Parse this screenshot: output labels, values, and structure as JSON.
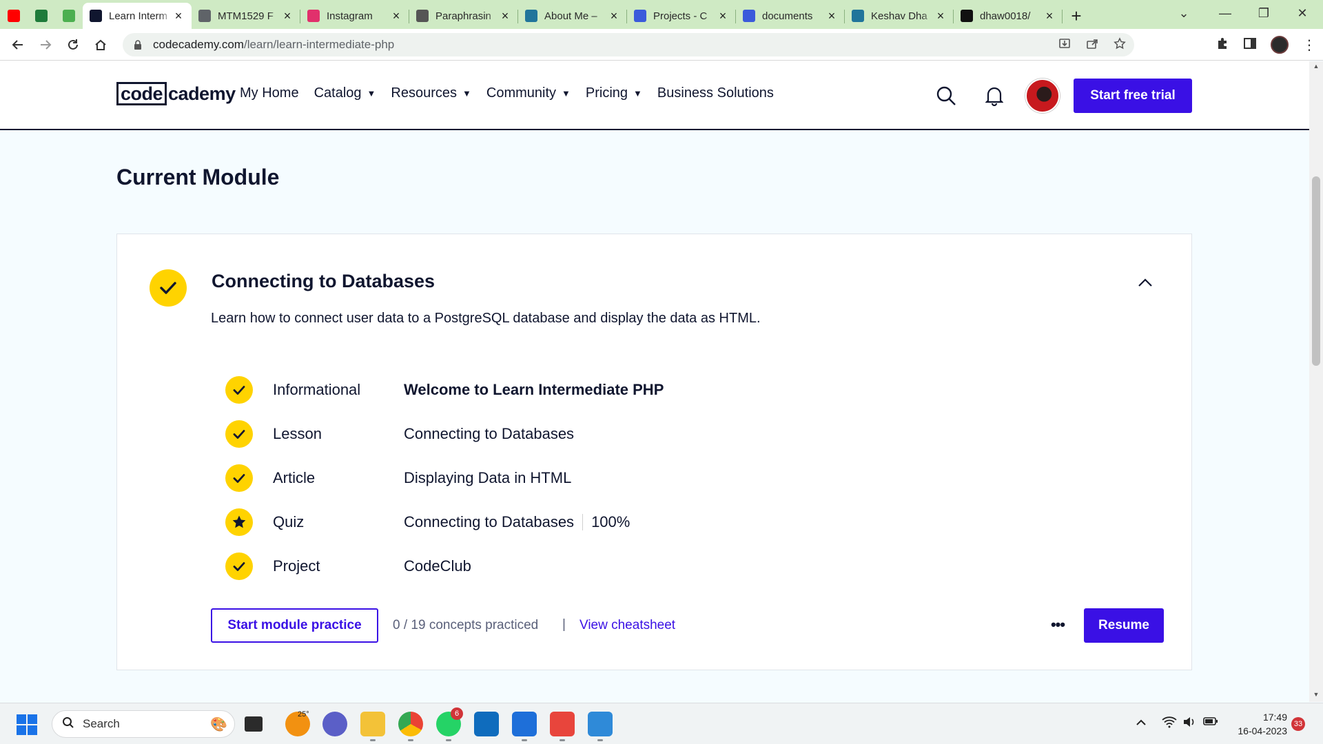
{
  "browser": {
    "tabs": [
      {
        "label": "",
        "favicon": "youtube-icon",
        "color": "#ff0000",
        "pinned": true
      },
      {
        "label": "",
        "favicon": "autocad-icon",
        "color": "#1e7b3a",
        "pinned": true
      },
      {
        "label": "",
        "favicon": "plant-icon",
        "color": "#4caf50",
        "pinned": true
      },
      {
        "label": "Learn Interm",
        "favicon": "codecademy-icon",
        "color": "#10162f",
        "active": true
      },
      {
        "label": "MTM1529 F",
        "favicon": "globe-icon",
        "color": "#5f6368"
      },
      {
        "label": "Instagram",
        "favicon": "instagram-icon",
        "color": "#e1306c"
      },
      {
        "label": "Paraphrasin",
        "favicon": "quill-icon",
        "color": "#555555"
      },
      {
        "label": "About Me –",
        "favicon": "wordpress-icon",
        "color": "#21759b"
      },
      {
        "label": "Projects - C",
        "favicon": "c-icon",
        "color": "#3b5bdb"
      },
      {
        "label": "documents",
        "favicon": "c-icon",
        "color": "#3b5bdb"
      },
      {
        "label": "Keshav Dha",
        "favicon": "wordpress-icon",
        "color": "#21759b"
      },
      {
        "label": "dhaw0018/",
        "favicon": "github-icon",
        "color": "#111111"
      }
    ],
    "url_host": "codecademy.com",
    "url_path": "/learn/learn-intermediate-php"
  },
  "header": {
    "logo_left": "code",
    "logo_right": "cademy",
    "nav": [
      {
        "label": "My Home",
        "dropdown": false
      },
      {
        "label": "Catalog",
        "dropdown": true
      },
      {
        "label": "Resources",
        "dropdown": true
      },
      {
        "label": "Community",
        "dropdown": true
      },
      {
        "label": "Pricing",
        "dropdown": true
      },
      {
        "label": "Business Solutions",
        "dropdown": false
      }
    ],
    "caret": "▼",
    "cta": "Start free trial"
  },
  "main": {
    "title": "Current Module",
    "module": {
      "name": "Connecting to Databases",
      "description": "Learn how to connect user data to a PostgreSQL database and display the data as HTML.",
      "items": [
        {
          "type": "Informational",
          "title": "Welcome to Learn Intermediate PHP",
          "status": "check",
          "bold": true,
          "score": ""
        },
        {
          "type": "Lesson",
          "title": "Connecting to Databases",
          "status": "check",
          "bold": false,
          "score": ""
        },
        {
          "type": "Article",
          "title": "Displaying Data in HTML",
          "status": "check",
          "bold": false,
          "score": ""
        },
        {
          "type": "Quiz",
          "title": "Connecting to Databases",
          "status": "star",
          "bold": false,
          "score": "100%"
        },
        {
          "type": "Project",
          "title": "CodeClub",
          "status": "check",
          "bold": false,
          "score": ""
        }
      ],
      "practice_button": "Start module practice",
      "concepts": "0 / 19 concepts practiced",
      "divider": "|",
      "cheatsheet": "View cheatsheet",
      "more": "•••",
      "resume": "Resume"
    }
  },
  "taskbar": {
    "search_placeholder": "Search",
    "weather_temp": "25°",
    "whatsapp_badge": "6",
    "notifications": "33",
    "time": "17:49",
    "date": "16-04-2023"
  },
  "colors": {
    "accent": "#3a10e5",
    "check_yellow": "#ffd300",
    "page_bg": "#f5fcff",
    "navy": "#10162f",
    "tab_strip": "#cfeac4"
  }
}
